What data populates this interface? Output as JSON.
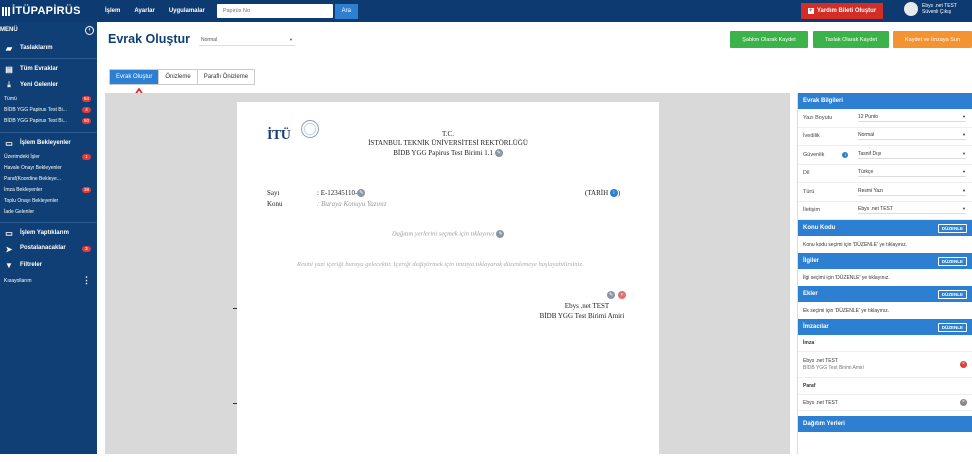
{
  "topbar": {
    "logo": "İTÜPAPİRÜS",
    "nav": [
      "İşlem",
      "Ayarlar",
      "Uygulamalar"
    ],
    "search_placeholder": "Papirüs No",
    "search_button": "Ara",
    "help_button": "Yardım Bileti Oluştur",
    "user_name": "Ebys .net TEST",
    "user_unit": "Süvenli Çıkış"
  },
  "sidebar": {
    "menu_label": "MENÜ",
    "sections": {
      "taslaklar": "Taslaklarım",
      "tum_evraklar": "Tüm Evraklar",
      "yeni_gelenler": "Yeni Gelenler",
      "islem_bekleyenler": "İşlem Bekleyenler",
      "islem_yaptiklarim": "İşlem Yaptıklarım",
      "postalanacaklar": "Postalanacaklar",
      "filtreler": "Filtreler",
      "kisayollarim": "Kısayollarım"
    },
    "yeni_gelenler_items": [
      {
        "label": "Tümü",
        "badge": "54"
      },
      {
        "label": "BİDB YGG Papirus Test Bi...",
        "badge": "4"
      },
      {
        "label": "BİDB YGG Papirus Test Bi...",
        "badge": "50"
      }
    ],
    "islem_bekleyenler_items": [
      {
        "label": "Üzerimdeki İşler",
        "badge": "1"
      },
      {
        "label": "Havale Onayı Bekleyenler",
        "badge": ""
      },
      {
        "label": "Paraf(Koordine Bekleye...",
        "badge": ""
      },
      {
        "label": "İmza Bekleyenler",
        "badge": "38"
      },
      {
        "label": "Toplu Onayı Bekleyenler",
        "badge": ""
      },
      {
        "label": "İade Gelenler",
        "badge": ""
      }
    ],
    "postalanacaklar_badge": "2"
  },
  "main": {
    "title": "Evrak Oluştur",
    "template_select": "Normal",
    "buttons": {
      "sablon": "Şablon Olarak Kaydet",
      "taslak": "Taslak Olarak Kaydet",
      "kaydet_imzaya": "Kaydet ve İmzaya Sun"
    },
    "tabs": [
      "Evrak Oluştur",
      "Önizleme",
      "Paraflı Önizleme"
    ]
  },
  "document": {
    "logo": "İTÜ",
    "tc": "T.C.",
    "university": "İSTANBUL TEKNİK ÜNİVERSİTESİ REKTÖRLÜĞÜ",
    "unit": "BİDB YGG Papirus Test Birimi 1.1",
    "sayi_label": "Sayı",
    "sayi_value": ": E-12345110-",
    "tarih": "(TARİH",
    "konu_label": "Konu",
    "konu_value": ": Buraya Konuyu Yazınız",
    "dagitim": "Dağıtım yerlerini seçmek için tıklayınız",
    "body": "Resmi yazı içeriği buraya gelecektir. İçeriği değiştirmek için imzaya tıklayarak düzenlemeye başlayabilirsiniz.",
    "signer_name": "Ebys .net TEST",
    "signer_title": "BİDB YGG Test Birimi Amiri"
  },
  "right_panel": {
    "header": "Evrak Bilgileri",
    "fields": [
      {
        "label": "Yazı Boyutu",
        "value": "12 Punto"
      },
      {
        "label": "İvedilik",
        "value": "Normal"
      },
      {
        "label": "Güvenlik",
        "value": "Tasnif Dışı"
      },
      {
        "label": "Dil",
        "value": "Türkçe"
      },
      {
        "label": "Türü",
        "value": "Resmi Yazı"
      },
      {
        "label": "İletişim",
        "value": "Ebys .net TEST"
      }
    ],
    "duzenle": "DÜZENLE",
    "konu_kodu": {
      "title": "Konu Kodu",
      "text": "Konu kodu seçimi için 'DÜZENLE' ye tıklayınız."
    },
    "ilgiler": {
      "title": "İlgiler",
      "text": "İlgi seçimi için 'DÜZENLE' ye tıklayınız."
    },
    "ekler": {
      "title": "Ekler",
      "text": "Ek seçimi için 'DÜZENLE' ye tıklayınız."
    },
    "imzacilar": {
      "title": "İmzacılar",
      "imza_label": "İmza",
      "imza_name": "Ebys .net TEST",
      "imza_unit": "BİDB YGG Test Birimi Amiri",
      "paraf_label": "Paraf",
      "paraf_name": "Ebys .net TEST"
    },
    "dagitim": "Dağıtım Yerleri"
  },
  "colors": {
    "navy": "#0f3f74",
    "blue": "#2d7fd2",
    "green": "#3cb34a",
    "orange": "#f39332",
    "red": "#d32d27"
  }
}
